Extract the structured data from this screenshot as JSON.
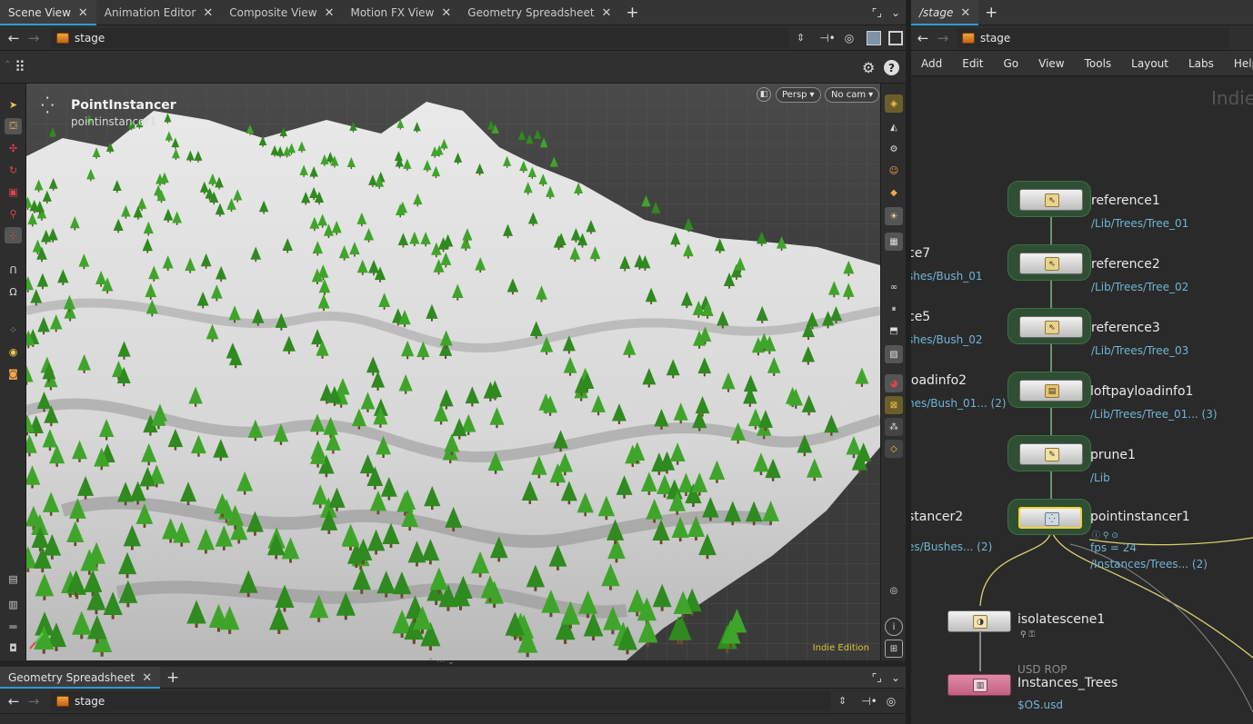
{
  "top_tabs": [
    {
      "label": "Scene View",
      "active": true
    },
    {
      "label": "Animation Editor",
      "active": false
    },
    {
      "label": "Composite View",
      "active": false
    },
    {
      "label": "Motion FX View",
      "active": false
    },
    {
      "label": "Geometry Spreadsheet",
      "active": false
    }
  ],
  "left_path": {
    "label": "stage"
  },
  "viewport": {
    "title": "PointInstancer",
    "subtitle": "pointinstancer1",
    "persp_label": "Persp",
    "cam_label": "No cam",
    "edition": "Indie Edition"
  },
  "network_tabs": [
    {
      "label": "/stage",
      "active": true
    }
  ],
  "network_path": {
    "label": "stage"
  },
  "network_menu": [
    "Add",
    "Edit",
    "Go",
    "View",
    "Tools",
    "Layout",
    "Labs",
    "Help"
  ],
  "network_watermark": "Indie",
  "nodes": [
    {
      "name": "reference1",
      "path": "/Lib/Trees/Tree_01"
    },
    {
      "name": "reference2",
      "path": "/Lib/Trees/Tree_02"
    },
    {
      "name": "reference3",
      "path": "/Lib/Trees/Tree_03"
    },
    {
      "name": "loftpayloadinfo1",
      "path": "/Lib/Trees/Tree_01... (3)"
    },
    {
      "name": "prune1",
      "path": "/Lib"
    },
    {
      "name": "pointinstancer1",
      "fps": "fps = 24",
      "path": "/Instances/Trees... (2)"
    },
    {
      "name": "isolatescene1"
    },
    {
      "type_label": "USD ROP",
      "name": "Instances_Trees",
      "path": "$OS.usd"
    }
  ],
  "partial_nodes": [
    {
      "name": "ce7",
      "path": "shes/Bush_01"
    },
    {
      "name": "ce5",
      "path": "shes/Bush_02"
    },
    {
      "name": "loadinfo2",
      "path": "hes/Bush_01... (2)"
    },
    {
      "name": "stancer2",
      "path": "es/Bushes... (2)"
    }
  ],
  "bottom_tabs": [
    {
      "label": "Geometry Spreadsheet",
      "active": true
    }
  ],
  "bottom_path": {
    "label": "stage"
  },
  "colors": {
    "accent": "#2f9bd1",
    "node_path": "#6fb4d6",
    "selected": "#f0d234",
    "usd_rop": "#d36b8f"
  }
}
